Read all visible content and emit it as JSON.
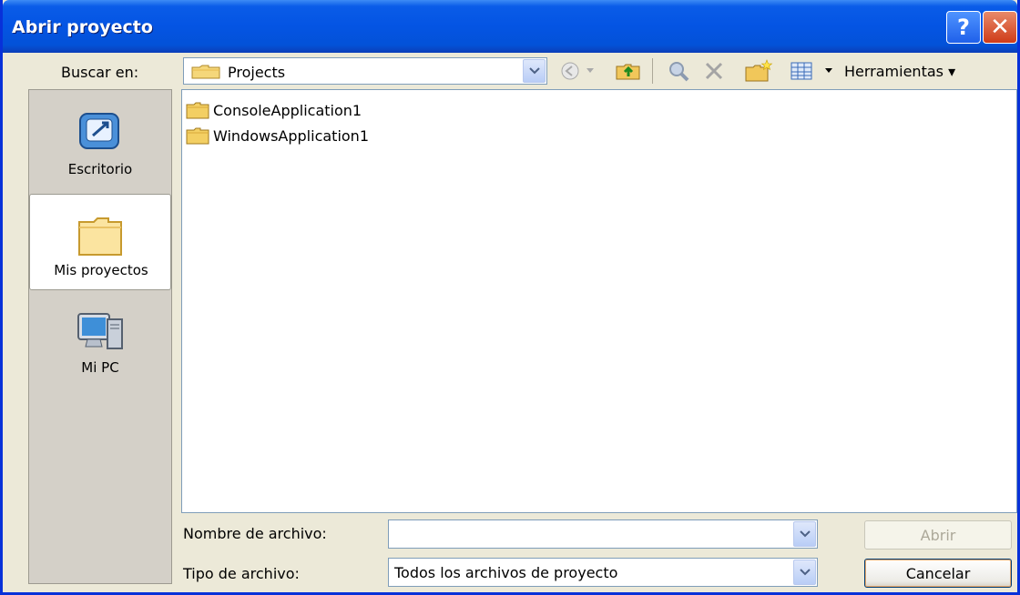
{
  "window": {
    "title": "Abrir proyecto"
  },
  "caption_buttons": {
    "help": "?",
    "close": "✕"
  },
  "look_in": {
    "label": "Buscar en:",
    "value": "Projects"
  },
  "toolbar": {
    "icons": [
      "back-icon",
      "up-folder-icon",
      "search-web-icon",
      "delete-icon",
      "new-folder-icon",
      "views-icon"
    ],
    "tools_label": "Herramientas ▾"
  },
  "places": [
    {
      "label": "Escritorio",
      "icon": "desktop-icon"
    },
    {
      "label": "Mis proyectos",
      "icon": "folder-icon",
      "selected": true
    },
    {
      "label": "Mi PC",
      "icon": "computer-icon"
    }
  ],
  "files": [
    {
      "name": "ConsoleApplication1",
      "icon": "folder-icon"
    },
    {
      "name": "WindowsApplication1",
      "icon": "folder-icon"
    }
  ],
  "file_name": {
    "label": "Nombre de archivo:",
    "value": ""
  },
  "file_type": {
    "label": "Tipo de archivo:",
    "value": "Todos los archivos de proyecto"
  },
  "buttons": {
    "open": "Abrir",
    "cancel": "Cancelar"
  },
  "colors": {
    "title_bar": "#0454e3",
    "window_bg": "#ece9d8",
    "close_button": "#cf3b18"
  }
}
